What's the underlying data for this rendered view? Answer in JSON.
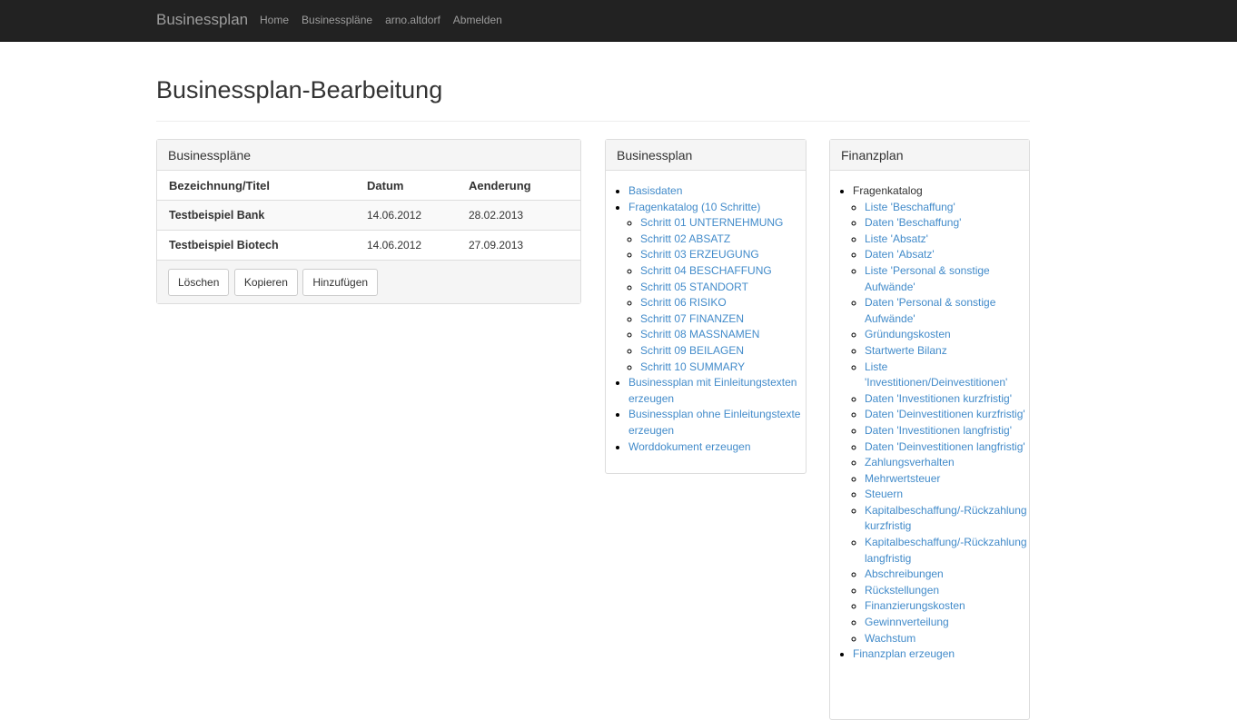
{
  "navbar": {
    "brand": "Businessplan",
    "links": [
      "Home",
      "Businesspläne",
      "arno.altdorf",
      "Abmelden"
    ]
  },
  "page_title": "Businessplan-Bearbeitung",
  "plans_panel": {
    "heading": "Businesspläne",
    "columns": [
      "Bezeichnung/Titel",
      "Datum",
      "Aenderung"
    ],
    "rows": [
      {
        "title": "Testbeispiel Bank",
        "date": "14.06.2012",
        "changed": "28.02.2013"
      },
      {
        "title": "Testbeispiel Biotech",
        "date": "14.06.2012",
        "changed": "27.09.2013"
      }
    ],
    "buttons": {
      "delete": "Löschen",
      "copy": "Kopieren",
      "add": "Hinzufügen"
    }
  },
  "businessplan_panel": {
    "heading": "Businessplan",
    "basisdaten": "Basisdaten",
    "fragenkatalog": "Fragenkatalog (10 Schritte)",
    "steps": [
      "Schritt 01 UNTERNEHMUNG",
      "Schritt 02 ABSATZ",
      "Schritt 03 ERZEUGUNG",
      "Schritt 04 BESCHAFFUNG",
      "Schritt 05 STANDORT",
      "Schritt 06 RISIKO",
      "Schritt 07 FINANZEN",
      "Schritt 08 MASSNAMEN",
      "Schritt 09 BEILAGEN",
      "Schritt 10 SUMMARY"
    ],
    "with_intro": "Businessplan mit Einleitungstexten erzeugen",
    "without_intro": "Businessplan ohne Einleitungstexte erzeugen",
    "word_doc": "Worddokument erzeugen"
  },
  "finanzplan_panel": {
    "heading": "Finanzplan",
    "fragenkatalog": "Fragenkatalog",
    "items": [
      "Liste 'Beschaffung'",
      "Daten 'Beschaffung'",
      "Liste 'Absatz'",
      "Daten 'Absatz'",
      "Liste 'Personal & sonstige Aufwände'",
      "Daten 'Personal & sonstige Aufwände'",
      "Gründungskosten",
      "Startwerte Bilanz",
      "Liste 'Investitionen/Deinvestitionen'",
      "Daten 'Investitionen kurzfristig'",
      "Daten 'Deinvestitionen kurzfristig'",
      "Daten 'Investitionen langfristig'",
      "Daten 'Deinvestitionen langfristig'",
      "Zahlungsverhalten",
      "Mehrwertsteuer",
      "Steuern",
      "Kapitalbeschaffung/-Rückzahlung kurzfristig",
      "Kapitalbeschaffung/-Rückzahlung langfristig",
      "Abschreibungen",
      "Rückstellungen",
      "Finanzierungskosten",
      "Gewinnverteilung",
      "Wachstum"
    ],
    "generate": "Finanzplan erzeugen"
  },
  "colors": {
    "navbar": "#222222",
    "link": "#428bca",
    "panel_heading": "#f5f5f5"
  }
}
